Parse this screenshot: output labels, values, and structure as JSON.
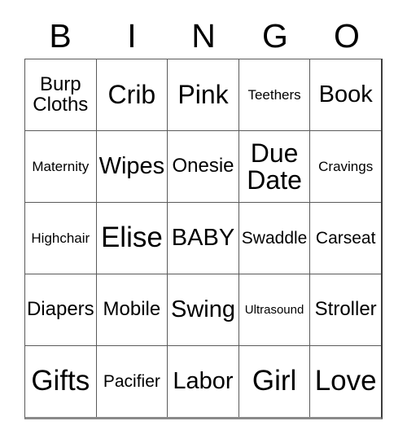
{
  "card": {
    "title": "BINGO",
    "header_letters": [
      "B",
      "I",
      "N",
      "G",
      "O"
    ],
    "colors": {
      "background": "#ffffff",
      "text": "#000000",
      "grid_line": "#5a5a5a",
      "grid_bottom": "#8a8a8a"
    },
    "grid": {
      "columns": 5,
      "rows": 5,
      "cells": [
        [
          {
            "text": "Burp\nCloths",
            "size": "m"
          },
          {
            "text": "Crib",
            "size": "xl"
          },
          {
            "text": "Pink",
            "size": "xl"
          },
          {
            "text": "Teethers",
            "size": "xs"
          },
          {
            "text": "Book",
            "size": "l"
          }
        ],
        [
          {
            "text": "Maternity",
            "size": "xs"
          },
          {
            "text": "Wipes",
            "size": "l"
          },
          {
            "text": "Onesie",
            "size": "m"
          },
          {
            "text": "Due\nDate",
            "size": "xl"
          },
          {
            "text": "Cravings",
            "size": "xs"
          }
        ],
        [
          {
            "text": "Highchair",
            "size": "xs"
          },
          {
            "text": "Elise",
            "size": "xxl"
          },
          {
            "text": "BABY",
            "size": "l"
          },
          {
            "text": "Swaddle",
            "size": "s"
          },
          {
            "text": "Carseat",
            "size": "s"
          }
        ],
        [
          {
            "text": "Diapers",
            "size": "m"
          },
          {
            "text": "Mobile",
            "size": "m"
          },
          {
            "text": "Swing",
            "size": "l"
          },
          {
            "text": "Ultrasound",
            "size": "xxs"
          },
          {
            "text": "Stroller",
            "size": "m"
          }
        ],
        [
          {
            "text": "Gifts",
            "size": "xxl"
          },
          {
            "text": "Pacifier",
            "size": "s"
          },
          {
            "text": "Labor",
            "size": "l"
          },
          {
            "text": "Girl",
            "size": "xxl"
          },
          {
            "text": "Love",
            "size": "xxl"
          }
        ]
      ]
    }
  }
}
